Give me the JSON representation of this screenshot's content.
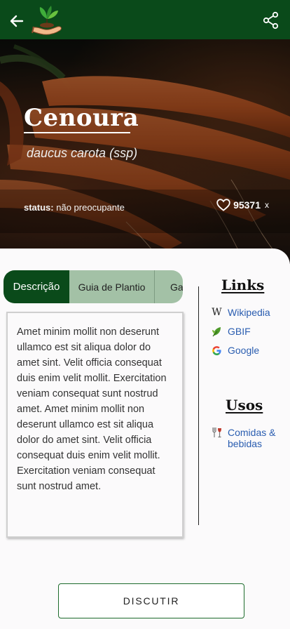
{
  "plant": {
    "name": "Cenoura",
    "scientific_name": "daucus carota (ssp)",
    "status_label": "status:",
    "status_value": "não preocupante",
    "likes_count": "95371",
    "likes_unit": "x"
  },
  "tabs": [
    {
      "label": "Descrição",
      "active": true
    },
    {
      "label": "Guia de Plantio",
      "active": false
    },
    {
      "label": "Ga",
      "active": false
    }
  ],
  "description": "Amet minim mollit non deserunt ullamco est sit aliqua dolor do amet sint. Velit officia consequat duis enim velit mollit. Exercitation veniam consequat sunt nostrud amet. Amet minim mollit non deserunt ullamco est sit aliqua dolor do amet sint. Velit officia consequat duis enim velit mollit. Exercitation veniam consequat sunt nostrud amet.",
  "links": {
    "title": "Links",
    "items": [
      {
        "label": "Wikipedia",
        "icon": "wikipedia-icon"
      },
      {
        "label": "GBIF",
        "icon": "gbif-leaf-icon"
      },
      {
        "label": "Google",
        "icon": "google-icon"
      }
    ]
  },
  "usos": {
    "title": "Usos",
    "items": [
      {
        "label": "Comidas & bebidas",
        "icon": "food-drink-icon"
      }
    ]
  },
  "actions": {
    "discutir": "DISCUTIR"
  },
  "colors": {
    "primary": "#0a4a1a",
    "tab_inactive": "#a3c1a6",
    "link": "#2a5db0"
  }
}
